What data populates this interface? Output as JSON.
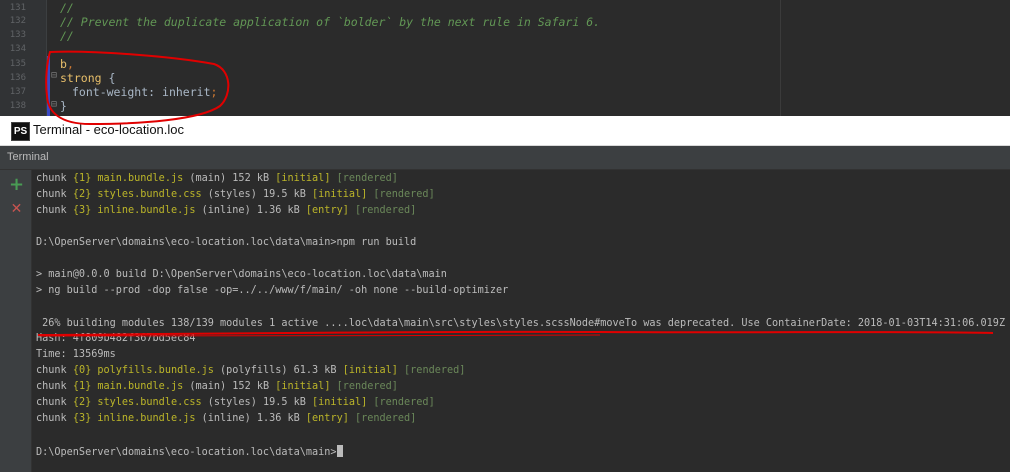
{
  "editor": {
    "lines": [
      {
        "num": "131",
        "text": "//"
      },
      {
        "num": "132",
        "text": "// Prevent the duplicate application of `bolder` by the next rule in Safari 6."
      },
      {
        "num": "133",
        "text": "//"
      },
      {
        "num": "134",
        "text": ""
      },
      {
        "num": "135",
        "tag": "b",
        "punct": ","
      },
      {
        "num": "136",
        "tag": "strong",
        "brace": " {"
      },
      {
        "num": "137",
        "prop": "font-weight",
        "colon": ": ",
        "value": "inherit",
        "semi": ";"
      },
      {
        "num": "138",
        "close": "}"
      }
    ]
  },
  "window": {
    "logo": "PS",
    "title": "Terminal - eco-location.loc"
  },
  "terminal": {
    "panel_label": "Terminal",
    "add_icon": "+",
    "close_icon": "✕",
    "lines": [
      {
        "a": "chunk ",
        "b": "{1}",
        "c": " main.bundle.js",
        "d": " (main) 152 kB ",
        "e": "[initial]",
        "f": " [rendered]"
      },
      {
        "a": "chunk ",
        "b": "{2}",
        "c": " styles.bundle.css",
        "d": " (styles) 19.5 kB ",
        "e": "[initial]",
        "f": " [rendered]"
      },
      {
        "a": "chunk ",
        "b": "{3}",
        "c": " inline.bundle.js",
        "d": " (inline) 1.36 kB ",
        "e": "[entry]",
        "f": " [rendered]"
      },
      {
        "plain": ""
      },
      {
        "plain": "D:\\OpenServer\\domains\\eco-location.loc\\data\\main>npm run build"
      },
      {
        "plain": ""
      },
      {
        "plain": "> main@0.0.0 build D:\\OpenServer\\domains\\eco-location.loc\\data\\main"
      },
      {
        "plain": "> ng build --prod -dop false -op=../../www/f/main/ -oh none --build-optimizer"
      },
      {
        "plain": ""
      },
      {
        "plain": " 26% building modules 138/139 modules 1 active ....loc\\data\\main\\src\\styles\\styles.scssNode#moveTo was deprecated. Use ContainerDate: 2018-01-03T14:31:06.019Z"
      },
      {
        "plain": "Hash: 4f809b482f367bd5ec84"
      },
      {
        "plain": "Time: 13569ms"
      },
      {
        "a": "chunk ",
        "b": "{0}",
        "c": " polyfills.bundle.js",
        "d": " (polyfills) 61.3 kB ",
        "e": "[initial]",
        "f": " [rendered]"
      },
      {
        "a": "chunk ",
        "b": "{1}",
        "c": " main.bundle.js",
        "d": " (main) 152 kB ",
        "e": "[initial]",
        "f": " [rendered]"
      },
      {
        "a": "chunk ",
        "b": "{2}",
        "c": " styles.bundle.css",
        "d": " (styles) 19.5 kB ",
        "e": "[initial]",
        "f": " [rendered]"
      },
      {
        "a": "chunk ",
        "b": "{3}",
        "c": " inline.bundle.js",
        "d": " (inline) 1.36 kB ",
        "e": "[entry]",
        "f": " [rendered]"
      },
      {
        "plain": ""
      },
      {
        "plain": "D:\\OpenServer\\domains\\eco-location.loc\\data\\main>"
      }
    ]
  },
  "colors": {
    "background": "#2b2b2b",
    "comment": "#629755",
    "tag": "#e8bf6a",
    "highlight_yellow": "#bbb529",
    "highlight_green": "#6a8759",
    "annotation_red": "#e00000",
    "add_green": "#499c54",
    "close_red": "#c75450"
  }
}
